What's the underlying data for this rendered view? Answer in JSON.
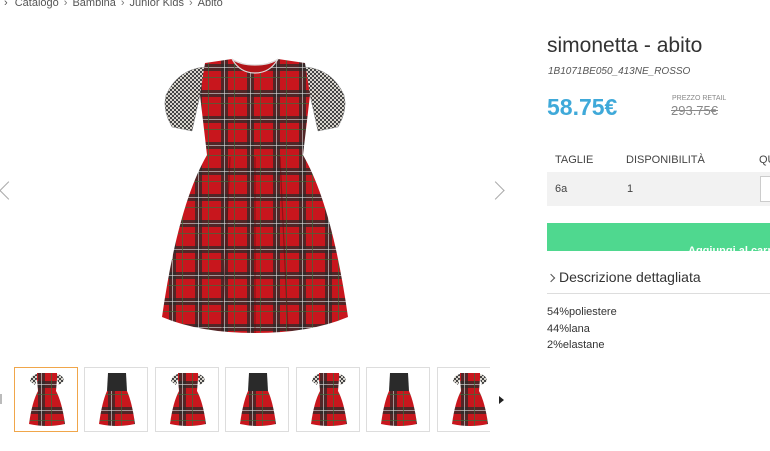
{
  "breadcrumb": {
    "prefix": "›",
    "items": [
      "Catalogo",
      "Bambina",
      "Junior Kids",
      "Abito"
    ],
    "separator": "›"
  },
  "product": {
    "title": "simonetta - abito",
    "sku": "1B1071BE050_413NE_ROSSO",
    "price": "58.75€",
    "retail_label": "PREZZO RETAIL",
    "retail_price": "293.75€"
  },
  "table": {
    "headers": [
      "TAGLIE",
      "DISPONIBILITÀ",
      "QUANTITÀ"
    ],
    "rows": [
      {
        "size": "6a",
        "availability": "1"
      }
    ]
  },
  "add_to_cart_label": "Aggiungi al carrello",
  "description": {
    "heading": "Descrizione dettagliata",
    "lines": [
      "54%poliestere",
      "44%lana",
      "2%elastane"
    ]
  },
  "gallery": {
    "thumbnails": [
      "dress-front-sleeves",
      "dress-front-sleeveless",
      "dress-front-sleeves",
      "dress-front-sleeveless",
      "dress-front-sleeves",
      "dress-front-sleeveless",
      "dress-front-sleeves"
    ],
    "active_index": 0
  },
  "colors": {
    "accent_price": "#3fa9d9",
    "cart_button": "#4fd88f",
    "tartan_red": "#c8161d",
    "tartan_dark": "#2a2a2a"
  }
}
